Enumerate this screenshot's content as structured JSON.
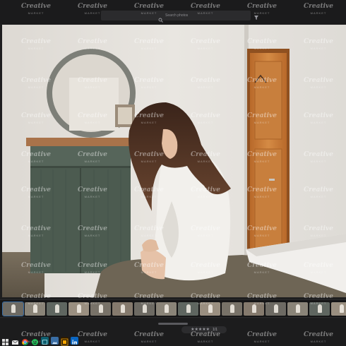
{
  "toolbar": {
    "search_placeholder": "Search photos",
    "search_icon": "magnifier-icon",
    "filter_icon": "funnel-icon"
  },
  "photo": {
    "subject": "photo-woman-sitting-on-bed"
  },
  "filmstrip": {
    "thumbnail_count": 16
  },
  "bottom": {
    "rating_stars": "★★★★★",
    "rating_count": "1/1"
  },
  "taskbar": {
    "icons": [
      "windows-icon",
      "mail-icon",
      "chrome-icon",
      "spotify-icon",
      "app-icon",
      "photos-icon",
      "illustrator-icon",
      "linkedin-icon"
    ]
  },
  "watermark": {
    "text": "Creative",
    "subtext": "MARKET"
  },
  "colors": {
    "background": "#1e1e1f",
    "accent": "#3a6ea5",
    "wall": "#e6e2dc",
    "cabinet": "#4f5e52",
    "door": "#c47a36"
  }
}
